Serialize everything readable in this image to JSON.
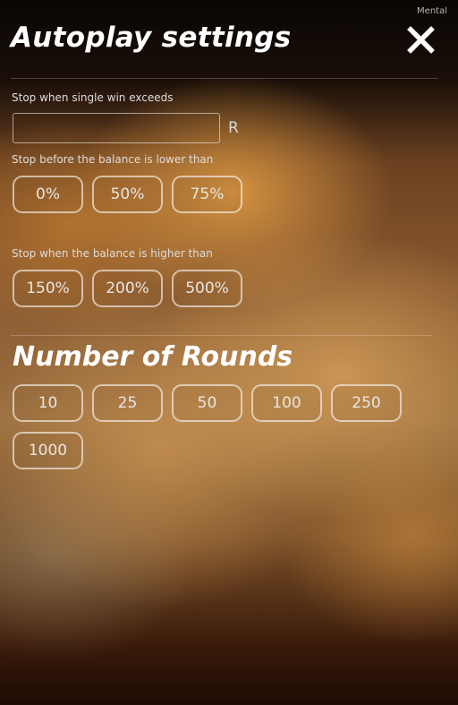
{
  "brand_label": "Mental",
  "title": "Autoplay settings",
  "single_win": {
    "label": "Stop when single win exceeds",
    "value": "",
    "currency": "R"
  },
  "balance_lower": {
    "label": "Stop before the balance is lower than",
    "options": [
      "0%",
      "50%",
      "75%"
    ]
  },
  "balance_higher": {
    "label": "Stop when the balance is higher than",
    "options": [
      "150%",
      "200%",
      "500%"
    ]
  },
  "rounds": {
    "title": "Number of Rounds",
    "options": [
      "10",
      "25",
      "50",
      "100",
      "250",
      "1000"
    ]
  },
  "icons": {
    "close": "close-icon"
  }
}
